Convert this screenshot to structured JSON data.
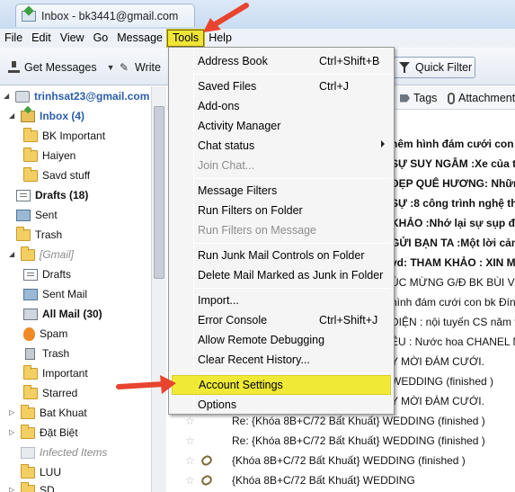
{
  "window": {
    "title": "Inbox - bk3441@gmail.com",
    "tab_icon": "envelope-icon"
  },
  "menubar": [
    "File",
    "Edit",
    "View",
    "Go",
    "Message",
    "Tools",
    "Help"
  ],
  "toolbar": {
    "get_messages": "Get Messages",
    "write": "Write",
    "quick_filter": "Quick Filter"
  },
  "folders": [
    {
      "label": "trinhsat23@gmail.com",
      "icon": "account-icon"
    },
    {
      "label": "Inbox (4)",
      "icon": "inbox-icon"
    },
    {
      "label": "BK Important",
      "icon": "folder-icon"
    },
    {
      "label": "Haiyen",
      "icon": "folder-icon"
    },
    {
      "label": "Savd stuff",
      "icon": "folder-icon"
    },
    {
      "label": "Drafts (18)",
      "icon": "drafts-icon"
    },
    {
      "label": "Sent",
      "icon": "sent-icon"
    },
    {
      "label": "Trash",
      "icon": "trash-icon"
    },
    {
      "label": "[Gmail]",
      "icon": "folder-icon"
    },
    {
      "label": "Drafts",
      "icon": "drafts-icon"
    },
    {
      "label": "Sent Mail",
      "icon": "sent-icon"
    },
    {
      "label": "All Mail (30)",
      "icon": "all-mail-icon"
    },
    {
      "label": "Spam",
      "icon": "spam-icon"
    },
    {
      "label": "Trash",
      "icon": "trash-icon"
    },
    {
      "label": "Important",
      "icon": "folder-icon"
    },
    {
      "label": "Starred",
      "icon": "folder-icon"
    },
    {
      "label": "Bat Khuat",
      "icon": "folder-icon"
    },
    {
      "label": "Đặt Biệt",
      "icon": "folder-icon"
    },
    {
      "label": "Infected Items",
      "icon": "folder-icon"
    },
    {
      "label": "LUU",
      "icon": "folder-icon"
    },
    {
      "label": "SD",
      "icon": "folder-icon"
    }
  ],
  "message_header": {
    "tags": "Tags",
    "attachment": "Attachment"
  },
  "messages": [
    "hêm hình đám cưới con b",
    "SỰ SUY NGẪM :Xe của t",
    "ĐẸP QUÊ HƯƠNG: Những",
    "SỰ :8 công trình nghệ th",
    "KHẢO :Nhớ lại sự sụp đ",
    "GỬI BẠN TA :Một lời cảm",
    "vd: THAM KHẢO : XIN M",
    "ÚC MỪNG G/Đ BK BÙI VĂN",
    "hình đám cưới con bk Đính",
    "DIỆN : nội tuyến CS năm v",
    "ÊU : Nước hoa CHANEL Nổ",
    "Y MỜI ĐÁM CƯỚI.",
    "WEDDING (finished )",
    "Y MỜI ĐÁM CƯỚI.",
    "Re: {Khóa 8B+C/72 Bất Khuất} WEDDING (finished )",
    "Re: {Khóa 8B+C/72 Bất Khuất} WEDDING (finished )",
    "{Khóa 8B+C/72 Bất Khuất} WEDDING (finished )",
    "{Khóa 8B+C/72 Bất Khuất} WEDDING"
  ],
  "tools_menu": {
    "address_book": "Address Book",
    "address_book_shortcut": "Ctrl+Shift+B",
    "saved_files": "Saved Files",
    "saved_files_shortcut": "Ctrl+J",
    "add_ons": "Add-ons",
    "activity_manager": "Activity Manager",
    "chat_status": "Chat status",
    "join_chat": "Join Chat...",
    "message_filters": "Message Filters",
    "run_filters_on_folder": "Run Filters on Folder",
    "run_filters_on_message": "Run Filters on Message",
    "run_junk_controls": "Run Junk Mail Controls on Folder",
    "delete_junk": "Delete Mail Marked as Junk in Folder",
    "import": "Import...",
    "error_console": "Error Console",
    "error_console_shortcut": "Ctrl+Shift+J",
    "remote_debugging": "Allow Remote Debugging",
    "clear_history": "Clear Recent History...",
    "account_settings": "Account Settings",
    "options": "Options"
  },
  "colors": {
    "menu_highlight": "#f0ea36",
    "arrow": "#e8442f",
    "link_blue": "#2c5ea8"
  }
}
